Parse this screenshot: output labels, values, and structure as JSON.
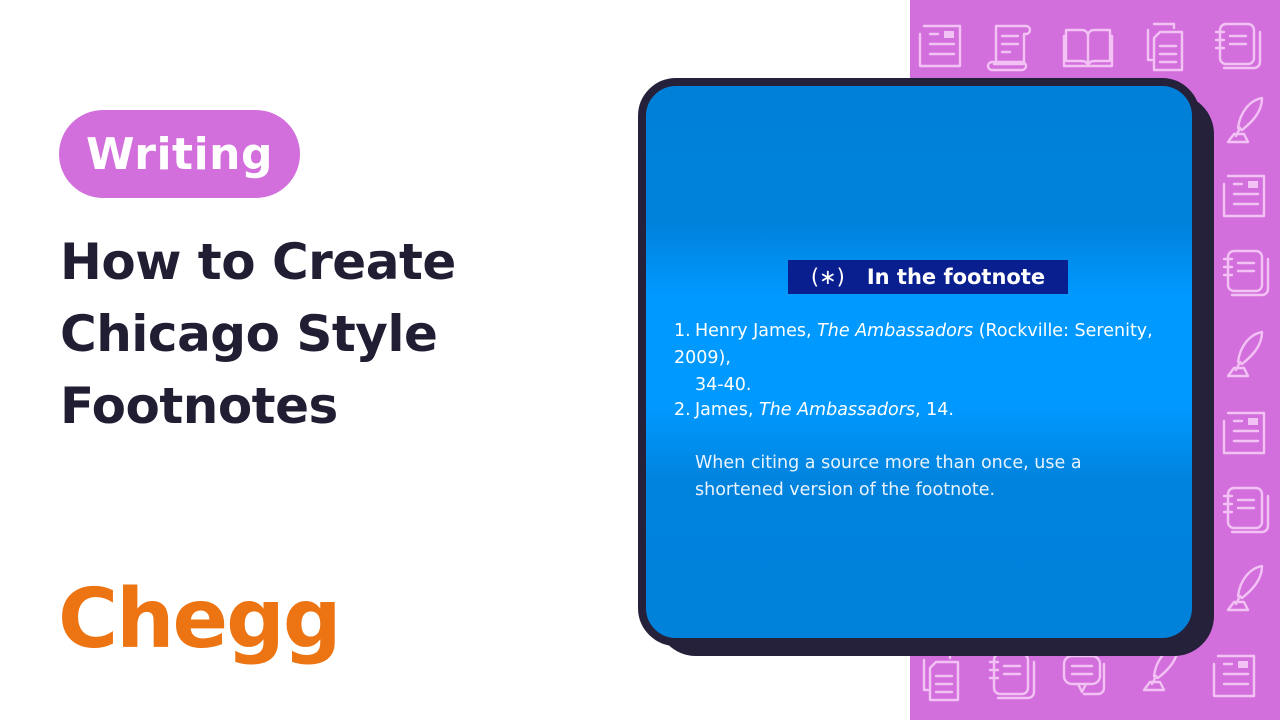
{
  "category": {
    "label": "Writing"
  },
  "title": {
    "lines": [
      "How to Create",
      "Chicago Style",
      "Footnotes"
    ]
  },
  "brand": {
    "name": "Chegg"
  },
  "card": {
    "section_label": {
      "symbol": "(∗)",
      "text": "In the footnote"
    },
    "notes": [
      {
        "number": "1.",
        "author": "Henry James, ",
        "work": "The Ambassadors",
        "rest": " (Rockville: Serenity, 2009),",
        "continuation": "34-40."
      },
      {
        "number": "2.",
        "author": "James, ",
        "work": "The Ambassadors",
        "rest": ", 14.",
        "continuation": ""
      }
    ],
    "explanation": "When citing a source more than once, use a shortened version of the footnote."
  },
  "colors": {
    "accent_pink": "#d36fdc",
    "title_dark": "#211d33",
    "brand_orange": "#ed7412",
    "card_blue": "#0099ff",
    "card_border": "#26213a",
    "label_navy": "#0a1f8f"
  },
  "pattern": {
    "icons": [
      "newspaper-icon",
      "scroll-icon",
      "open-book-icon",
      "documents-icon",
      "notebook-icon",
      "quill-icon",
      "chat-icon"
    ]
  }
}
